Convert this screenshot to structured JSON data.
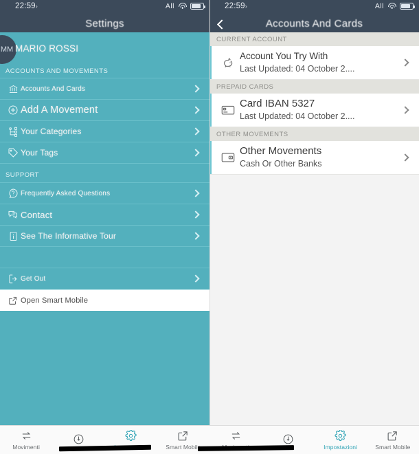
{
  "status_bar": {
    "time": "22:59",
    "location_arrow": "›",
    "carrier": "All",
    "wifi_icon": "wifi-icon",
    "battery_icon": "battery-icon"
  },
  "left_panel": {
    "navbar": {
      "title": "Settings"
    },
    "profile": {
      "initials": "MM",
      "name": "MARIO ROSSI"
    },
    "sections": [
      {
        "caption": "ACCOUNTS AND MOVEMENTS",
        "items": [
          {
            "label": "Accounts And Cards",
            "icon": "bank-icon",
            "size": "sm"
          },
          {
            "label": "Add A Movement",
            "icon": "plus-circle-icon",
            "size": "big"
          },
          {
            "label": "Your Categories",
            "icon": "category-tree-icon",
            "size": "mid"
          },
          {
            "label": "Your Tags",
            "icon": "tag-icon",
            "size": "mid"
          }
        ]
      },
      {
        "caption": "SUPPORT",
        "items": [
          {
            "label": "Frequently Asked Questions",
            "icon": "question-bubble-icon",
            "size": "sm"
          },
          {
            "label": "Contact",
            "icon": "chat-bubbles-icon",
            "size": "midb"
          },
          {
            "label": "See The Informative Tour",
            "icon": "info-document-icon",
            "size": "mid"
          }
        ]
      }
    ],
    "logout": {
      "label": "Get Out",
      "icon": "logout-icon"
    },
    "smart_mobile": {
      "label": "Open Smart Mobile",
      "icon": "external-link-icon"
    }
  },
  "right_panel": {
    "navbar": {
      "title": "Accounts And Cards",
      "back_icon": "back-chevron-icon"
    },
    "groups": [
      {
        "caption": "CURRENT ACCOUNT",
        "rows": [
          {
            "icon": "piggy-bank-icon",
            "title": "Account You Try With",
            "subtitle": "Last Updated: 04 October 2....",
            "title_size": "normal"
          }
        ]
      },
      {
        "caption": "PREPAID CARDS",
        "rows": [
          {
            "icon": "credit-card-icon",
            "title": "Card IBAN 5327",
            "subtitle": "Last Updated: 04 October 2....",
            "title_size": "large"
          }
        ]
      },
      {
        "caption": "OTHER MOVEMENTS",
        "rows": [
          {
            "icon": "wallet-icon",
            "title": "Other Movements",
            "subtitle": "Cash Or Other Banks",
            "title_size": "large"
          }
        ]
      }
    ]
  },
  "tabbar": {
    "tabs": [
      {
        "label": "Movimenti",
        "icon": "transfer-arrows-icon",
        "active": false
      },
      {
        "label": "",
        "icon": "download-circle-icon",
        "active": false,
        "redacted": true
      },
      {
        "label": "Impostazioni",
        "icon": "gear-icon",
        "active": true,
        "redacted": true
      },
      {
        "label": "Smart Mobile",
        "icon": "external-link-icon",
        "active": false
      }
    ]
  },
  "colors": {
    "teal": "#53b0bd",
    "teal_border": "#6bc0cb",
    "navbar": "#3c4a5a",
    "accent_stripe": "#6ec6d2",
    "tab_active": "#2fa3b5",
    "group_caption_bg": "#e2e2dd"
  }
}
